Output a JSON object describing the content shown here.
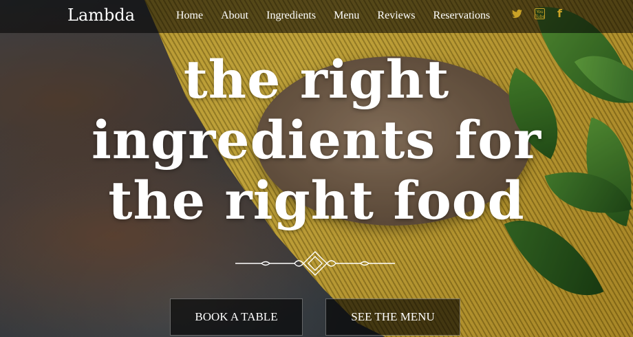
{
  "brand": "Lambda",
  "nav": {
    "items": [
      "Home",
      "About",
      "Ingredients",
      "Menu",
      "Reviews",
      "Reservations"
    ]
  },
  "social": {
    "icons": [
      "twitter-icon",
      "youtube-icon",
      "facebook-icon"
    ],
    "youtube_text": "You\nTube",
    "facebook_glyph": "f",
    "accent_color": "#c9a227"
  },
  "hero": {
    "headline_lines": [
      "the right",
      "ingredients for",
      "the right food"
    ]
  },
  "buttons": {
    "book_label": "BOOK A TABLE",
    "menu_label": "SEE THE MENU"
  }
}
